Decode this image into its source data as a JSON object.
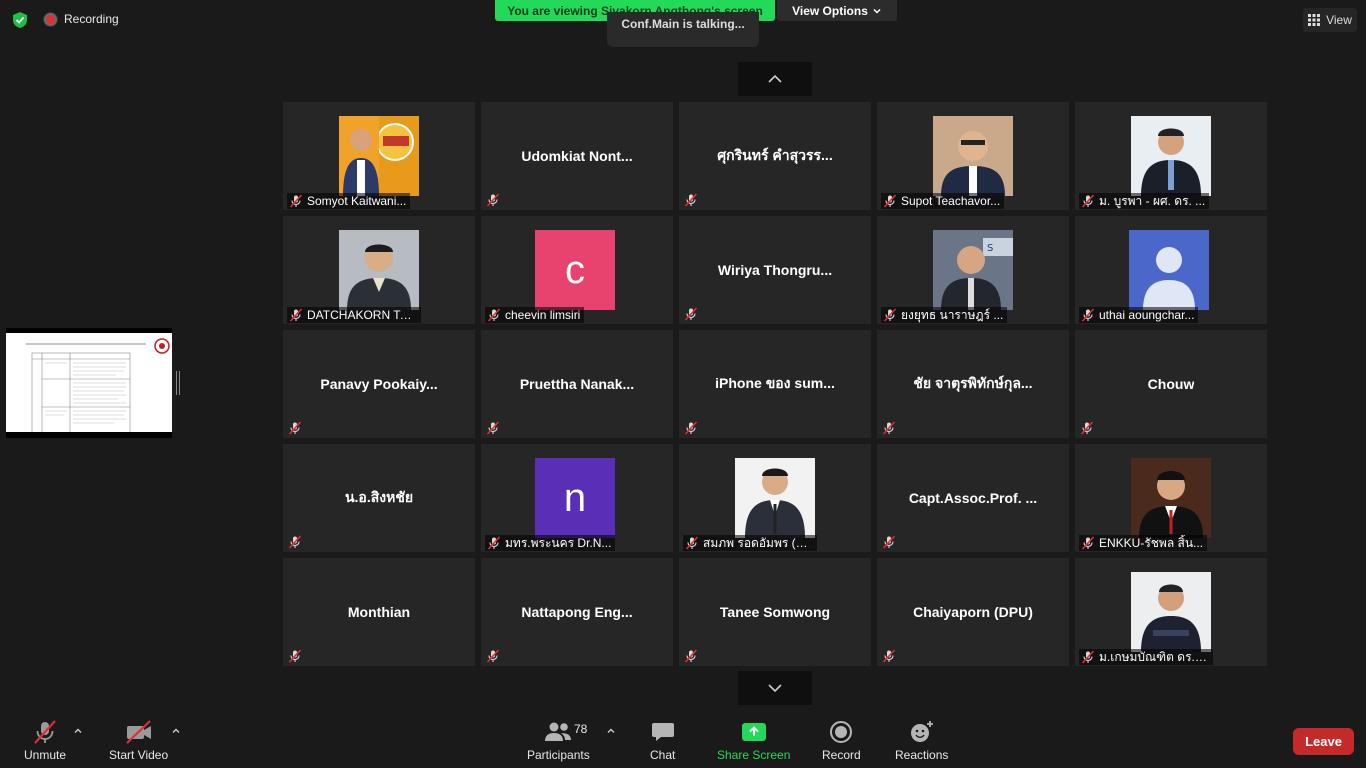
{
  "top": {
    "recording_label": "Recording",
    "viewing_banner": "You are viewing Sivakorn Angthong's screen",
    "view_options": "View Options",
    "talking": "Conf.Main is talking...",
    "view_label": "View"
  },
  "tiles": [
    {
      "label": "Somyot Kaitwani...",
      "type": "photo",
      "photo": "p1"
    },
    {
      "center": "Udomkiat  Nont...",
      "type": "name"
    },
    {
      "center": "ศุกรินทร์ คำสุวรร...",
      "type": "name"
    },
    {
      "label": "Supot Teachavor...",
      "type": "photo",
      "photo": "p2"
    },
    {
      "label": "ม. บูรพา - ผศ. ดร. ...",
      "type": "photo",
      "photo": "p3"
    },
    {
      "label": "DATCHAKORN TA...",
      "type": "photo",
      "photo": "p4"
    },
    {
      "label": "cheevin limsiri",
      "type": "letter",
      "letter": "c",
      "color": "#e8436e"
    },
    {
      "center": "Wiriya  Thongru...",
      "type": "name"
    },
    {
      "label": "ยงยุทธ  นาราษฎร์ ...",
      "type": "photo",
      "photo": "p5"
    },
    {
      "label": "uthai aoungchar...",
      "type": "generic"
    },
    {
      "center": "Panavy  Pookaiy...",
      "type": "name"
    },
    {
      "center": "Pruettha  Nanak...",
      "type": "name"
    },
    {
      "center": "iPhone ของ sum...",
      "type": "name"
    },
    {
      "center": "ชัย จาตุรพิทักษ์กุล...",
      "type": "name"
    },
    {
      "center": "Chouw",
      "type": "name"
    },
    {
      "center": "น.อ.สิงหชัย",
      "type": "name"
    },
    {
      "label": "มทร.พระนคร Dr.N...",
      "type": "letter",
      "letter": "n",
      "color": "#5b2eb8"
    },
    {
      "label": "สมภพ รอดอัมพร (ม...",
      "type": "photo",
      "photo": "p6"
    },
    {
      "center": "Capt.Assoc.Prof. ...",
      "type": "name"
    },
    {
      "label": "ENKKU-รัชพล สิ้น...",
      "type": "photo",
      "photo": "p7"
    },
    {
      "center": "Monthian",
      "type": "name"
    },
    {
      "center": "Nattapong  Eng...",
      "type": "name"
    },
    {
      "center": "Tanee Somwong",
      "type": "name"
    },
    {
      "center": "Chaiyaporn (DPU)",
      "type": "name"
    },
    {
      "label": "ม.เกษมบัณฑิต ดร.ศ...",
      "type": "photo",
      "photo": "p8"
    }
  ],
  "toolbar": {
    "unmute": "Unmute",
    "start_video": "Start Video",
    "participants": "Participants",
    "participants_count": "78",
    "chat": "Chat",
    "share_screen": "Share Screen",
    "record": "Record",
    "reactions": "Reactions",
    "leave": "Leave"
  },
  "colors": {
    "banner_green": "#23d959",
    "share_green": "#23d959",
    "leave_red": "#c52a2a",
    "tile_bg": "#262626"
  }
}
